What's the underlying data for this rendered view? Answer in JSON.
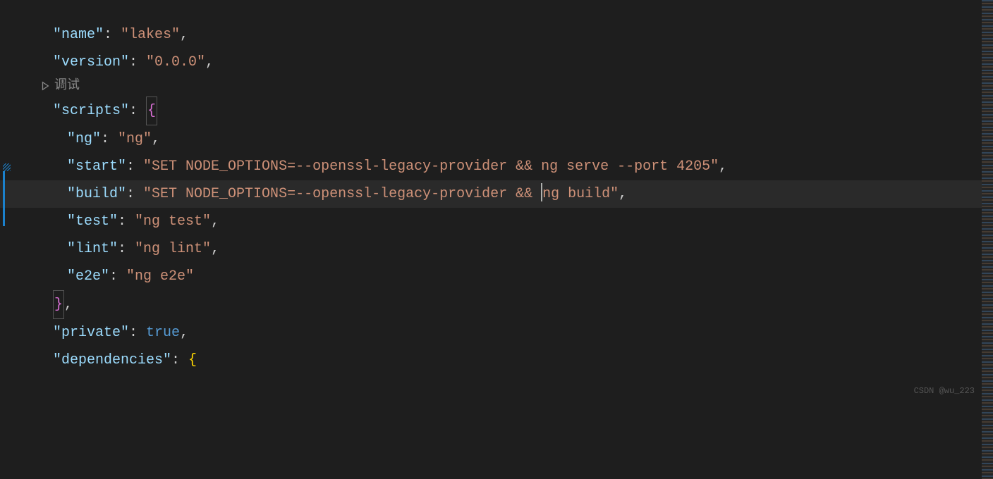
{
  "json": {
    "name_key": "\"name\"",
    "name_val": "\"lakes\"",
    "version_key": "\"version\"",
    "version_val": "\"0.0.0\"",
    "scripts_key": "\"scripts\"",
    "ng_key": "\"ng\"",
    "ng_val": "\"ng\"",
    "start_key": "\"start\"",
    "start_val": "\"SET NODE_OPTIONS=--openssl-legacy-provider && ng serve --port 4205\"",
    "build_key": "\"build\"",
    "build_val_part1": "\"SET NODE_OPTIONS=--openssl-legacy-provider && ",
    "build_val_part2": "ng build\"",
    "test_key": "\"test\"",
    "test_val": "\"ng test\"",
    "lint_key": "\"lint\"",
    "lint_val": "\"ng lint\"",
    "e2e_key": "\"e2e\"",
    "e2e_val": "\"ng e2e\"",
    "private_key": "\"private\"",
    "private_val": "true",
    "dependencies_key": "\"dependencies\""
  },
  "codelens": {
    "debug": "调试"
  },
  "watermark": "CSDN @wu_223"
}
